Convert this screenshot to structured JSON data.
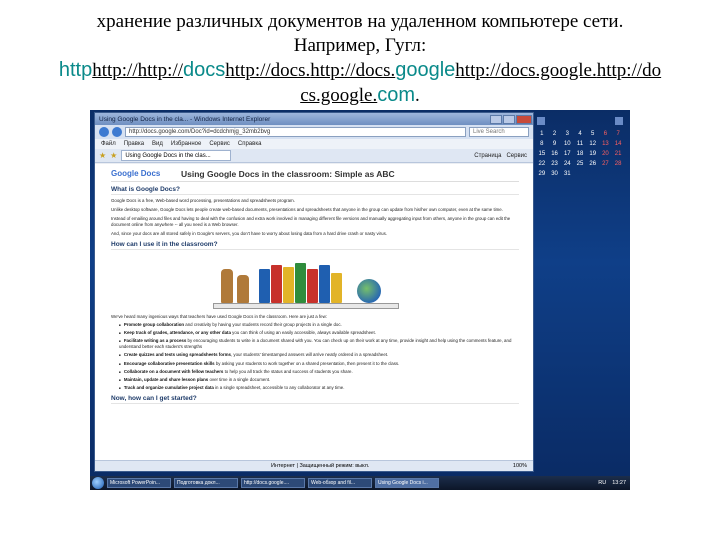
{
  "slide": {
    "line0": "",
    "line1": "хранение различных документов на удаленном компьютере сети.",
    "line2": "Например, Гугл:",
    "link_fragments": [
      {
        "text": "http",
        "style": "big"
      },
      {
        "text": "http://",
        "style": "plain"
      },
      {
        "text": "http://",
        "style": "plain"
      },
      {
        "text": "docs",
        "style": "big"
      },
      {
        "text": "http://docs.",
        "style": "plain"
      },
      {
        "text": "http://docs.",
        "style": "plain"
      },
      {
        "text": "google",
        "style": "big"
      },
      {
        "text": "http://docs.google.",
        "style": "plain"
      },
      {
        "text": "http://do",
        "style": "plain"
      }
    ],
    "link_line2_a": "cs.google.",
    "link_line2_b": "com",
    "link_line2_c": "."
  },
  "browser": {
    "title": "Using Google Docs in the cla... - Windows Internet Explorer",
    "address": "http://docs.google.com/Doc?id=dcdchmjg_32mb2bvg",
    "search_placeholder": "Live Search",
    "menu": [
      "Файл",
      "Правка",
      "Вид",
      "Избранное",
      "Сервис",
      "Справка"
    ],
    "tab_label": "Using Google Docs in the clas...",
    "tools": [
      "Страница",
      "Сервис"
    ],
    "status_zone": "Интернет | Защищенный режим: выкл.",
    "zoom": "100%"
  },
  "document": {
    "logo": "Google Docs",
    "title": "Using Google Docs in the classroom: Simple as ABC",
    "sections": {
      "what": "What is Google Docs?",
      "how": "How can I use it in the classroom?",
      "start": "Now, how can I get started?"
    },
    "intro": [
      "Google Docs is a free, Web-based word processing, presentations and spreadsheets program.",
      "Unlike desktop software, Google Docs lets people create web-based documents, presentations and spreadsheets that anyone in the group can update from his/her own computer, even at the same time.",
      "Instead of emailing around files and having to deal with the confusion and extra work involved in managing different file versions and manually aggregating input from others, anyone in the group can edit the document online from anywhere -- all you need is a Web browser.",
      "And, since your docs are all stored safely in Google's servers, you don't have to worry about losing data from a hard drive crash or nasty virus."
    ],
    "ways_intro": "We've heard many ingenious ways that teachers have used Google Docs in the classroom. Here are just a few:",
    "ways": [
      {
        "bold": "Promote group collaboration",
        "rest": " and creativity by having your students record their group projects in a single doc."
      },
      {
        "bold": "Keep track of grades, attendance, or any other data",
        "rest": " you can think of using an easily accessible, always available spreadsheet."
      },
      {
        "bold": "Facilitate writing as a process",
        "rest": " by encouraging students to write in a document shared with you. You can check up on their work at any time, provide insight and help using the comments feature, and understand better each student's strengths"
      },
      {
        "bold": "Create quizzes and tests using spreadsheets forms",
        "rest": ", your students' timestamped answers will arrive neatly ordered in a spreadsheet."
      },
      {
        "bold": "Encourage collaborative presentation skills",
        "rest": " by asking your students to work together on a shared presentation, then present it to the class."
      },
      {
        "bold": "Collaborate on a document with fellow teachers",
        "rest": " to help you all track the status and success of students you share."
      },
      {
        "bold": "Maintain, update and share lesson plans",
        "rest": " over time in a single document."
      },
      {
        "bold": "Track and organize cumulative project data",
        "rest": " in a single spreadsheet, accessible to any collaborator at any time."
      }
    ]
  },
  "taskbar": {
    "tasks": [
      "Microsoft PowerPoin...",
      "Подготовка докл...",
      "http://docs.google....",
      "Web-обзор and fil...",
      "Using Google Docs i..."
    ],
    "lang": "RU",
    "time": "13:27"
  },
  "calendar": {
    "days": [
      "1",
      "2",
      "3",
      "4",
      "5",
      "6",
      "7",
      "8",
      "9",
      "10",
      "11",
      "12",
      "13",
      "14",
      "15",
      "16",
      "17",
      "18",
      "19",
      "20",
      "21",
      "22",
      "23",
      "24",
      "25",
      "26",
      "27",
      "28",
      "29",
      "30",
      "31"
    ]
  }
}
